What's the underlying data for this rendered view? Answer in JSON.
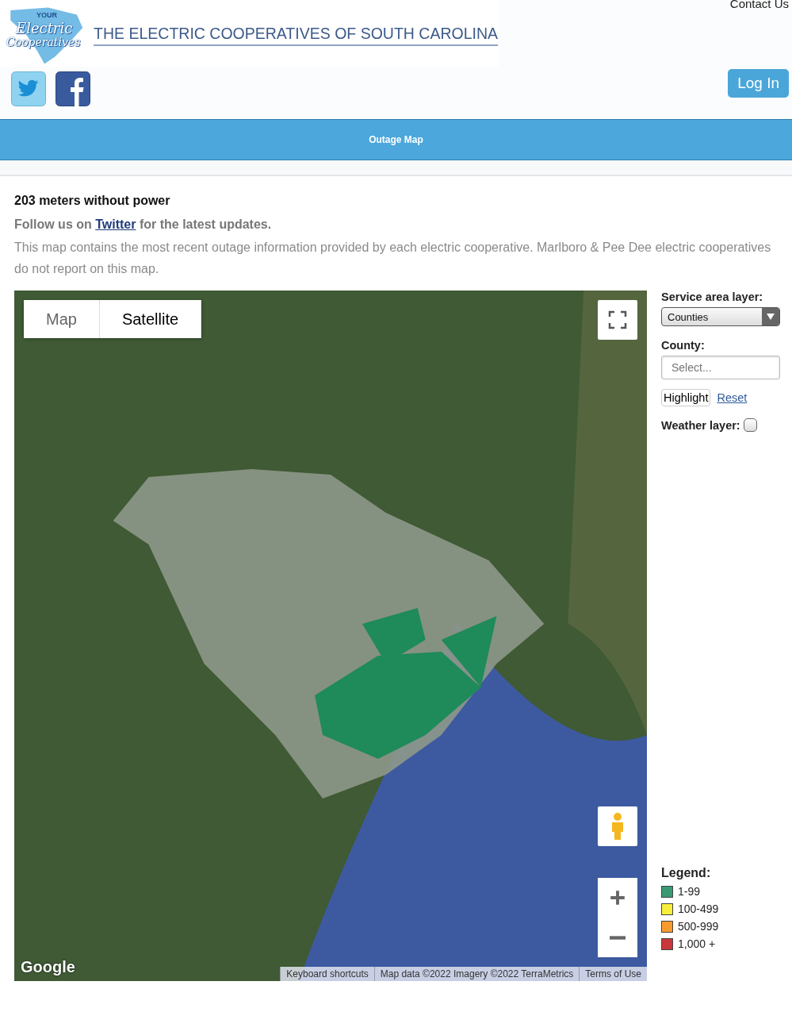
{
  "header": {
    "contact_link": "Contact Us",
    "logo": {
      "small": "YOUR",
      "line1": "Electric",
      "line2": "Cooperatives"
    },
    "site_title": "THE ELECTRIC COOPERATIVES OF SOUTH CAROLINA",
    "login_button": "Log In"
  },
  "nav": {
    "items": [
      {
        "label": "Outage Map",
        "selected": true
      }
    ]
  },
  "summary": {
    "headline": "203 meters without power",
    "follow": {
      "before": "Follow us on ",
      "link": "Twitter",
      "after": " for the latest updates."
    },
    "note": "This map contains the most recent outage information provided by each electric cooperative. Marlboro & Pee Dee electric cooperatives do not report on this map."
  },
  "map": {
    "type_tabs": [
      {
        "label": "Map",
        "selected": false
      },
      {
        "label": "Satellite",
        "selected": true
      }
    ],
    "google_logo": "Google",
    "footer_links": [
      "Keyboard shortcuts",
      "Map data ©2022 Imagery ©2022 TerraMetrics",
      "Terms of Use"
    ]
  },
  "sidebar": {
    "service_area_label": "Service area layer:",
    "service_area_value": "Counties",
    "county_label": "County:",
    "county_placeholder": "Select...",
    "highlight_button": "Highlight",
    "reset_link": "Reset",
    "weather_label": "Weather layer:",
    "weather_checked": false,
    "legend_title": "Legend:",
    "legend": [
      {
        "label": "1-99",
        "color": "#3a9a74"
      },
      {
        "label": "100-499",
        "color": "#f6ee3a"
      },
      {
        "label": "500-999",
        "color": "#f79b2f"
      },
      {
        "label": "1,000 +",
        "color": "#c9373a"
      }
    ]
  }
}
